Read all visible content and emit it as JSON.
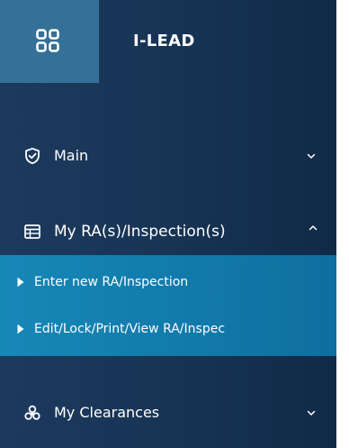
{
  "brand": {
    "title": "I-LEAD",
    "icon": "grid-icon"
  },
  "nav": {
    "main": {
      "label": "Main",
      "icon": "shield-check-icon",
      "chevron": "chevron-down-icon"
    },
    "ra": {
      "label": "My RA(s)/Inspection(s)",
      "icon": "table-icon",
      "chevron": "chevron-up-icon"
    },
    "clearances": {
      "label": "My Clearances",
      "icon": "biohazard-icon",
      "chevron": "chevron-down-icon"
    }
  },
  "submenu": {
    "items": [
      {
        "label": "Enter new RA/Inspection",
        "icon": "caret-right-icon"
      },
      {
        "label": "Edit/Lock/Print/View RA/Inspec",
        "icon": "caret-right-icon"
      }
    ]
  },
  "colors": {
    "sidebar_bg": "#183556",
    "brand_box": "#357196",
    "submenu_bg": "#1688b7",
    "text": "#ffffff"
  }
}
